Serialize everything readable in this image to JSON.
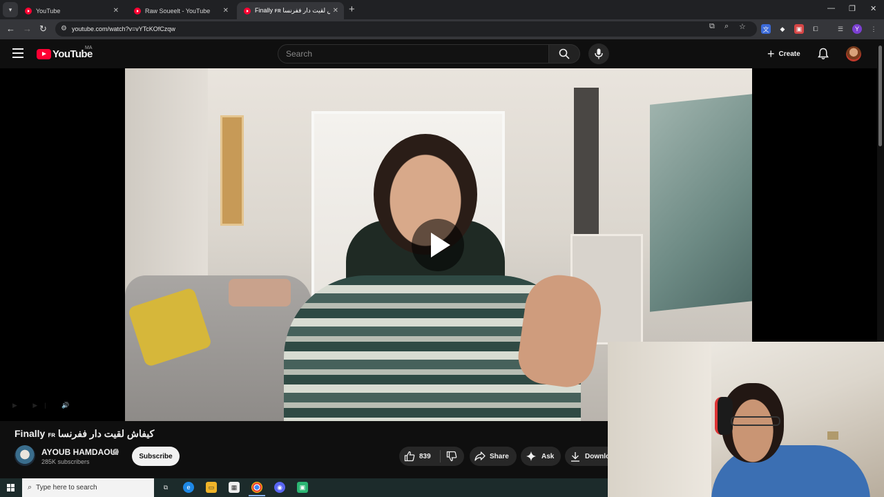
{
  "browser": {
    "tabs": [
      {
        "label": "YouTube",
        "active": false
      },
      {
        "label": "Raw Soueelt - YouTube",
        "active": false
      },
      {
        "label": "Finally ꜰʀ كيفاش لقيت دار ففرنسا",
        "active": true
      }
    ],
    "url": "youtube.com/watch?v=vYTcKOfCzqw",
    "profile_initial": "Y"
  },
  "header": {
    "logo_text": "YouTube",
    "country_code": "MA",
    "search_placeholder": "Search",
    "create_label": "Create"
  },
  "video": {
    "title_prefix": "Finally",
    "title_tag": "ꜰʀ",
    "title_arabic": "كيفاش لقيت دار ففرنسا",
    "channel_name": "AYOUB HAMDAOUI",
    "subscribers": "285K subscribers",
    "subscribe_label": "Subscribe",
    "likes": "839",
    "share_label": "Share",
    "ask_label": "Ask",
    "download_label": "Downlo"
  },
  "taskbar": {
    "search_placeholder": "Type here to search"
  },
  "colors": {
    "brand_red": "#ff0033",
    "background": "#0f0f0f",
    "pill_bg": "#272727"
  }
}
